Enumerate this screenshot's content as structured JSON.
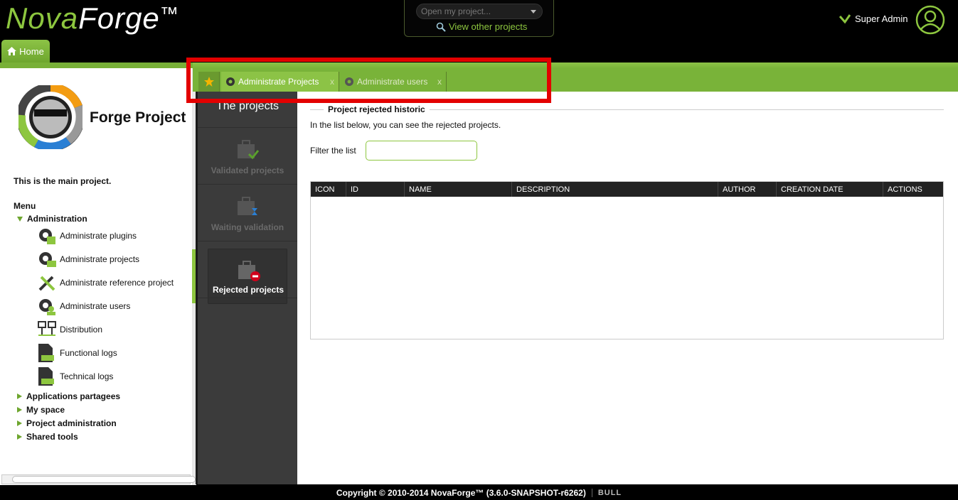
{
  "header": {
    "logo_nova": "Nova",
    "logo_forge": "Forge",
    "logo_tm": "™",
    "project_select_placeholder": "Open my project...",
    "view_other_projects": "View other projects",
    "user_name": "Super Admin",
    "home_tab": "Home"
  },
  "sidebar": {
    "forge_title": "Forge Project",
    "main_project_text": "This is the main project.",
    "menu_title": "Menu",
    "administration": {
      "label": "Administration",
      "items": [
        {
          "label": "Administrate plugins",
          "icon": "gear-puzzle-icon"
        },
        {
          "label": "Administrate projects",
          "icon": "gear-projects-icon"
        },
        {
          "label": "Administrate reference project",
          "icon": "wrench-screwdriver-icon"
        },
        {
          "label": "Administrate users",
          "icon": "gear-user-icon"
        },
        {
          "label": "Distribution",
          "icon": "distribution-icon"
        },
        {
          "label": "Functional logs",
          "icon": "log-file-icon"
        },
        {
          "label": "Technical logs",
          "icon": "log-file-icon"
        }
      ]
    },
    "collapsed_nodes": [
      "Applications partagees",
      "My space",
      "Project administration",
      "Shared tools"
    ]
  },
  "tabs": {
    "items": [
      {
        "label": "Administrate Projects",
        "active": true,
        "close": "x"
      },
      {
        "label": "Administrate users",
        "active": false,
        "close": "x"
      }
    ]
  },
  "projects_panel": {
    "title": "The projects",
    "items": [
      {
        "label": "Validated projects",
        "active": false
      },
      {
        "label": "Waiting validation",
        "active": false
      },
      {
        "label": "Rejected projects",
        "active": true
      }
    ]
  },
  "main": {
    "legend": "Project rejected historic",
    "description": "In the list below, you can see the rejected projects.",
    "filter_label": "Filter the list",
    "filter_value": "",
    "columns": [
      "ICON",
      "ID",
      "NAME",
      "DESCRIPTION",
      "AUTHOR",
      "CREATION DATE",
      "ACTIONS"
    ]
  },
  "footer": {
    "copyright": "Copyright © 2010-2014 NovaForge™ (3.6.0-SNAPSHOT-r6262)",
    "bull_logo": "BULL"
  },
  "colors": {
    "accent_green": "#8dc63f",
    "dark_green": "#6ea62e",
    "highlight_red": "#e30000"
  }
}
